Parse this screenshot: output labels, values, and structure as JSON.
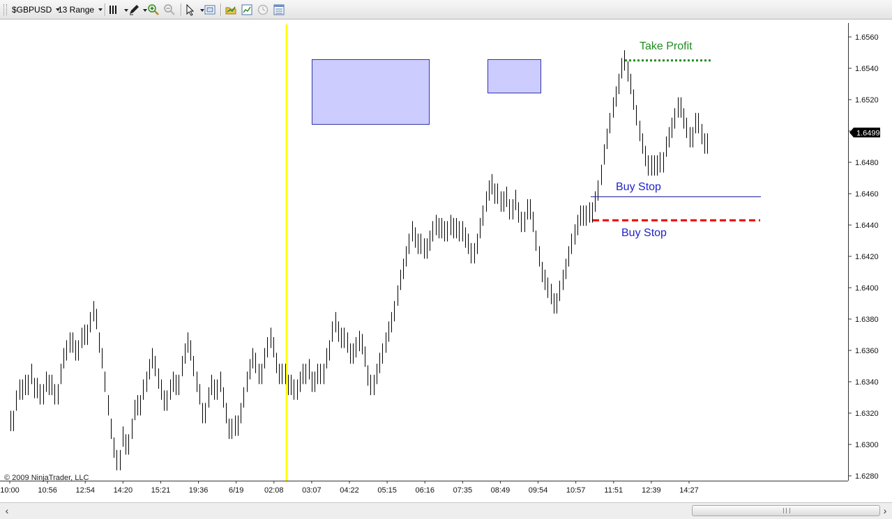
{
  "toolbar": {
    "instrument_label": "$GBPUSD",
    "interval_label": "13 Range"
  },
  "annotations": {
    "take_profit_label": "Take Profit",
    "buy_stop_upper_label": "Buy Stop",
    "buy_stop_lower_label": "Buy Stop"
  },
  "copyright": "© 2009 NinjaTrader, LLC",
  "colors": {
    "take_profit": "#228B22",
    "buy_stop_text": "#2222CC",
    "stop_line_red": "#EE0000",
    "vertical_marker": "#FFFF00",
    "rect_fill": "#CCCCFF",
    "rect_stroke": "#3333AA"
  },
  "icons": [
    "bars-style-icon",
    "pencil-draw-icon",
    "zoom-in-icon",
    "zoom-out-icon",
    "cursor-pointer-icon",
    "data-box-icon",
    "instrument-open-icon",
    "chart-properties-icon",
    "clock-icon",
    "data-grid-icon"
  ],
  "chart_data": {
    "type": "bar",
    "ylim": [
      1.6272,
      1.6568
    ],
    "y_ticks": [
      "1.6560",
      "1.6540",
      "1.6520",
      "1.6500",
      "1.6480",
      "1.6460",
      "1.6440",
      "1.6420",
      "1.6400",
      "1.6380",
      "1.6360",
      "1.6340",
      "1.6320",
      "1.6300",
      "1.6280"
    ],
    "x_tick_labels": [
      "10:00",
      "10:56",
      "12:54",
      "14:20",
      "15:21",
      "19:36",
      "6/19",
      "02:08",
      "03:07",
      "04:22",
      "05:15",
      "06:16",
      "07:35",
      "08:49",
      "09:54",
      "10:57",
      "11:51",
      "12:39",
      "14:27"
    ],
    "current_price": "1.6499",
    "take_profit_price": 1.6545,
    "buy_stop_upper_price": 1.6458,
    "buy_stop_lower_price": 1.6443,
    "price_path": [
      1.6315,
      1.6328,
      1.634,
      1.6335,
      1.6345,
      1.6338,
      1.635,
      1.6345,
      1.6336,
      1.6342,
      1.6332,
      1.634,
      1.6344,
      1.6338,
      1.6345,
      1.6332,
      1.6345,
      1.6355,
      1.636,
      1.637,
      1.6365,
      1.6372,
      1.636,
      1.6368,
      1.6375,
      1.637,
      1.6378,
      1.6385,
      1.6392,
      1.638,
      1.6365,
      1.6355,
      1.634,
      1.6325,
      1.631,
      1.6298,
      1.629,
      1.6305,
      1.6312,
      1.63,
      1.631,
      1.6322,
      1.633,
      1.6325,
      1.6335,
      1.634,
      1.6348,
      1.6355,
      1.636,
      1.635,
      1.6342,
      1.6335,
      1.6328,
      1.6335,
      1.634,
      1.6345,
      1.6338,
      1.635,
      1.6358,
      1.6365,
      1.6372,
      1.636,
      1.635,
      1.634,
      1.6332,
      1.632,
      1.633,
      1.6338,
      1.6345,
      1.6335,
      1.634,
      1.6345,
      1.633,
      1.632,
      1.631,
      1.6318,
      1.6312,
      1.632,
      1.633,
      1.634,
      1.6348,
      1.6355,
      1.6358,
      1.6352,
      1.6345,
      1.6355,
      1.6362,
      1.6368,
      1.637,
      1.6362,
      1.6352,
      1.6345,
      1.6352,
      1.6345,
      1.6338,
      1.6342,
      1.6335,
      1.634,
      1.635,
      1.6345,
      1.6352,
      1.6348,
      1.634,
      1.6345,
      1.6352,
      1.6345,
      1.6355,
      1.636,
      1.6372,
      1.638,
      1.6378,
      1.6372,
      1.6368,
      1.6376,
      1.6365,
      1.6358,
      1.6362,
      1.6366,
      1.6372,
      1.6364,
      1.6356,
      1.6344,
      1.6338,
      1.6345,
      1.6352,
      1.6358,
      1.6365,
      1.6372,
      1.6378,
      1.6385,
      1.6395,
      1.6405,
      1.6412,
      1.642,
      1.6428,
      1.6436,
      1.644,
      1.6432,
      1.6428,
      1.6432,
      1.6425,
      1.643,
      1.6436,
      1.644,
      1.6445,
      1.6438,
      1.6442,
      1.6436,
      1.644,
      1.6444,
      1.6438,
      1.6442,
      1.6436,
      1.644,
      1.6432,
      1.6428,
      1.6422,
      1.6428,
      1.6438,
      1.6446,
      1.6455,
      1.6462,
      1.647,
      1.6466,
      1.646,
      1.6465,
      1.6455,
      1.646,
      1.6458,
      1.645,
      1.6462,
      1.6456,
      1.6448,
      1.6442,
      1.645,
      1.6458,
      1.645,
      1.6442,
      1.643,
      1.642,
      1.641,
      1.6405,
      1.64,
      1.6396,
      1.639,
      1.6398,
      1.6405,
      1.6412,
      1.642,
      1.6428,
      1.6434,
      1.644,
      1.6446,
      1.645,
      1.6446,
      1.6452,
      1.6448,
      1.6455,
      1.6462,
      1.6472,
      1.6485,
      1.6495,
      1.6505,
      1.6515,
      1.6522,
      1.653,
      1.654,
      1.655,
      1.6545,
      1.6538,
      1.653,
      1.652,
      1.651,
      1.65,
      1.6492,
      1.6484,
      1.6478,
      1.6485,
      1.6478,
      1.6488,
      1.648,
      1.649,
      1.6496,
      1.6502,
      1.6508,
      1.6515,
      1.6524,
      1.6515,
      1.6508,
      1.6502,
      1.6496,
      1.6505,
      1.6512,
      1.6505,
      1.6498,
      1.6492,
      1.6499
    ]
  }
}
